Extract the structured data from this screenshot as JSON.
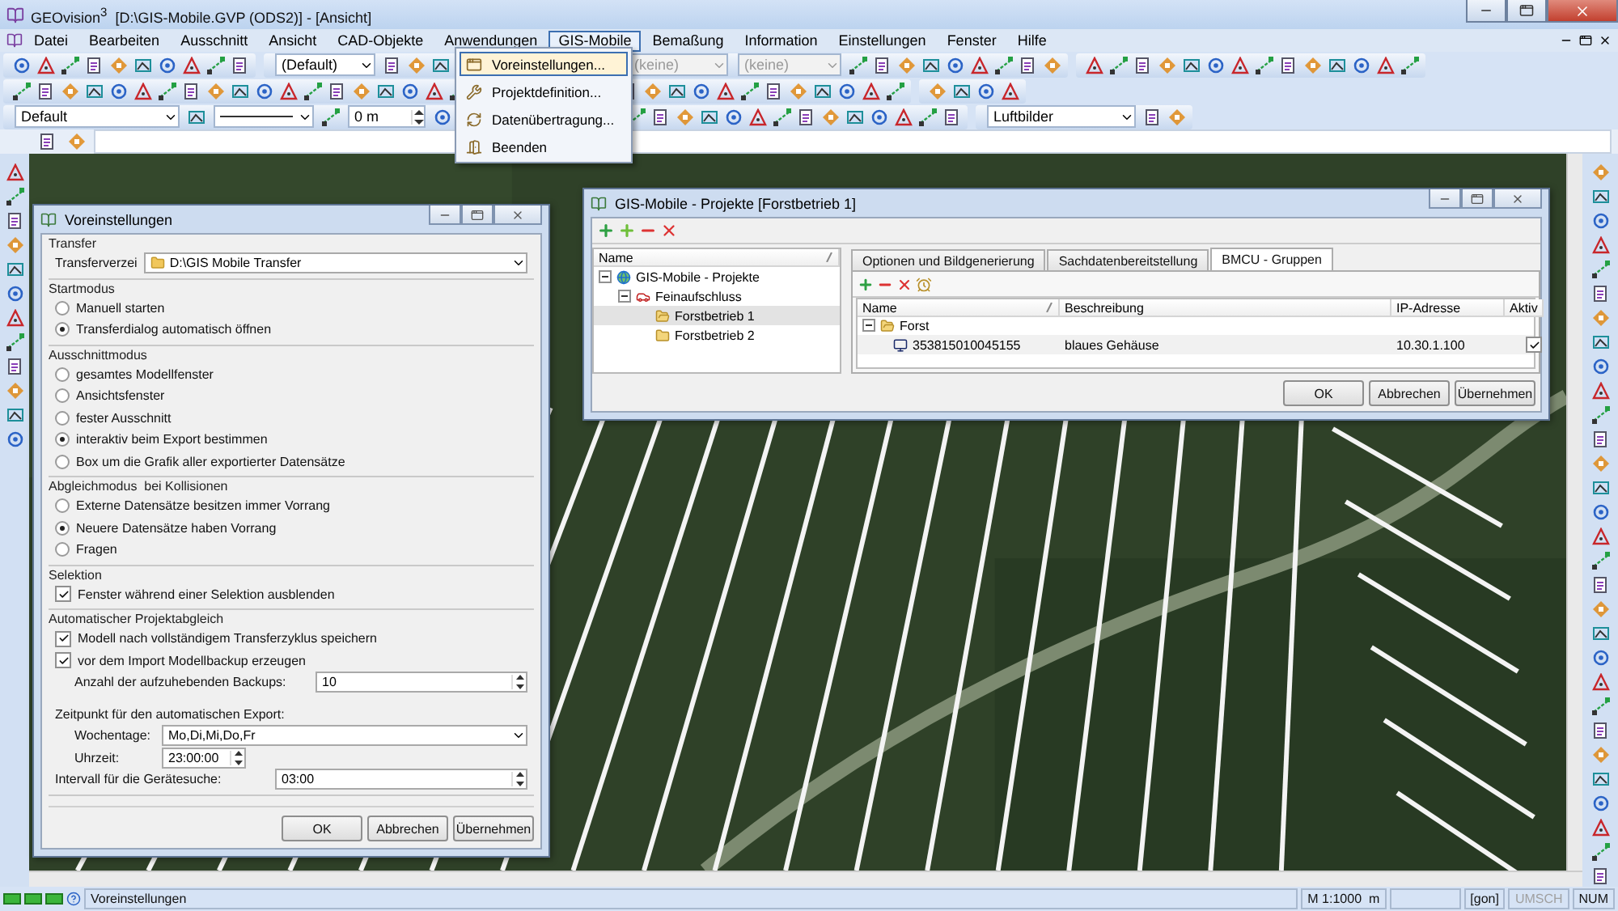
{
  "window": {
    "title": "GEOvision$^{3}$  [D:\\GIS-Mobile.GVP (ODS2)] - [Ansicht]"
  },
  "menu": [
    {
      "label": "Datei",
      "selected": false
    },
    {
      "label": "Bearbeiten",
      "selected": false
    },
    {
      "label": "Ausschnitt",
      "selected": false
    },
    {
      "label": "Ansicht",
      "selected": false
    },
    {
      "label": "CAD-Objekte",
      "selected": false
    },
    {
      "label": "Anwendungen",
      "selected": false
    },
    {
      "label": "GIS-Mobile",
      "selected": true
    },
    {
      "label": "Bemaßung",
      "selected": false
    },
    {
      "label": "Information",
      "selected": false
    },
    {
      "label": "Einstellungen",
      "selected": false
    },
    {
      "label": "Fenster",
      "selected": false
    },
    {
      "label": "Hilfe",
      "selected": false
    }
  ],
  "gis_menu": [
    {
      "label": "Voreinstellungen...",
      "selected": true
    },
    {
      "label": "Projektdefinition...",
      "selected": false
    },
    {
      "label": "Datenübertragung...",
      "selected": false
    },
    {
      "label": "Beenden",
      "selected": false
    }
  ],
  "toolbars": {
    "combos": [
      {
        "kind": "combo",
        "value": "(Default)",
        "disabled": false
      },
      {
        "kind": "combo",
        "value": "(keine)",
        "disabled": true
      },
      {
        "kind": "combo",
        "value": "(keine)",
        "disabled": true
      },
      {
        "kind": "combo",
        "value": "Default",
        "disabled": false
      },
      {
        "kind": "spin",
        "value": "0 m",
        "disabled": false
      },
      {
        "kind": "combo",
        "value": "Luftbilder",
        "disabled": false
      }
    ]
  },
  "prefs": {
    "title": "Voreinstellungen",
    "sections": [
      {
        "title": "Transfer",
        "rows": [
          {
            "kind": "combo",
            "label": "Transferverzei",
            "value": "D:\\GIS Mobile Transfer"
          }
        ]
      },
      {
        "title": "Startmodus",
        "rows": [
          {
            "kind": "radio",
            "label": "Manuell starten",
            "selected": false
          },
          {
            "kind": "radio",
            "label": "Transferdialog automatisch öffnen",
            "selected": true
          }
        ]
      },
      {
        "title": "Ausschnittmodus",
        "rows": [
          {
            "kind": "radio",
            "label": "gesamtes Modellfenster",
            "selected": false
          },
          {
            "kind": "radio",
            "label": "Ansichtsfenster",
            "selected": false
          },
          {
            "kind": "radio",
            "label": "fester Ausschnitt",
            "selected": false
          },
          {
            "kind": "radio",
            "label": "interaktiv beim Export bestimmen",
            "selected": true
          },
          {
            "kind": "radio",
            "label": "Box um die Grafik aller exportierter Datensätze",
            "selected": false
          }
        ]
      },
      {
        "title": "Abgleichmodus  bei Kollisionen",
        "rows": [
          {
            "kind": "radio",
            "label": "Externe Datensätze besitzen immer Vorrang",
            "selected": false
          },
          {
            "kind": "radio",
            "label": "Neuere Datensätze haben Vorrang",
            "selected": true
          },
          {
            "kind": "radio",
            "label": "Fragen",
            "selected": false
          }
        ]
      },
      {
        "title": "Selektion",
        "rows": [
          {
            "kind": "checkbox",
            "label": "Fenster während einer Selektion ausblenden",
            "checked": true
          }
        ]
      },
      {
        "title": "Automatischer Projektabgleich",
        "rows": [
          {
            "kind": "checkbox",
            "label": "Modell nach vollständigem Transferzyklus speichern",
            "checked": true
          },
          {
            "kind": "checkbox",
            "label": "vor dem Import Modellbackup erzeugen",
            "checked": true,
            "children": [
              {
                "kind": "spin",
                "label": "Anzahl der aufzuhebenden Backups:",
                "value": "10"
              }
            ]
          },
          {
            "kind": "note",
            "label": "Zeitpunkt für den automatischen Export:",
            "children": [
              {
                "kind": "combo",
                "label": "Wochentage:",
                "value": "Mo,Di,Mi,Do,Fr"
              },
              {
                "kind": "time",
                "label": "Uhrzeit:",
                "value": "23:00:00"
              }
            ]
          },
          {
            "kind": "spin",
            "label": "Intervall für die Gerätesuche:",
            "value": "03:00"
          }
        ]
      }
    ],
    "buttons": [
      "OK",
      "Abbrechen",
      "Übernehmen"
    ]
  },
  "projects": {
    "title": "GIS-Mobile - Projekte [Forstbetrieb 1]",
    "tree_header": "Name",
    "tree": [
      {
        "label": "GIS-Mobile - Projekte",
        "kind": "root",
        "expanded": true,
        "selected": false,
        "children": [
          {
            "label": "Feinaufschluss",
            "kind": "project",
            "expanded": true,
            "selected": false,
            "children": [
              {
                "label": "Forstbetrieb 1",
                "kind": "folder-open",
                "selected": true
              },
              {
                "label": "Forstbetrieb 2",
                "kind": "folder",
                "selected": false
              }
            ]
          }
        ]
      }
    ],
    "tabs": [
      {
        "label": "Optionen und Bildgenerierung",
        "selected": false
      },
      {
        "label": "Sachdatenbereitstellung",
        "selected": false
      },
      {
        "label": "BMCU - Gruppen",
        "selected": true
      }
    ],
    "table": {
      "columns": [
        "Name",
        "Beschreibung",
        "IP-Adresse",
        "Aktiv"
      ],
      "rows": [
        {
          "name": "Forst",
          "expanded": true,
          "children": [
            {
              "name": "353815010045155",
              "beschreibung": "blaues Gehäuse",
              "ip": "10.30.1.100",
              "aktiv": true
            }
          ]
        }
      ]
    },
    "buttons": [
      "OK",
      "Abbrechen",
      "Übernehmen"
    ]
  },
  "status_bar": {
    "message": "Voreinstellungen",
    "panels": [
      {
        "text": "M 1:1000  m",
        "disabled": false
      },
      {
        "text": "[gon]",
        "disabled": false
      },
      {
        "text": "UMSCH",
        "disabled": true
      },
      {
        "text": "NUM",
        "disabled": false
      }
    ]
  }
}
